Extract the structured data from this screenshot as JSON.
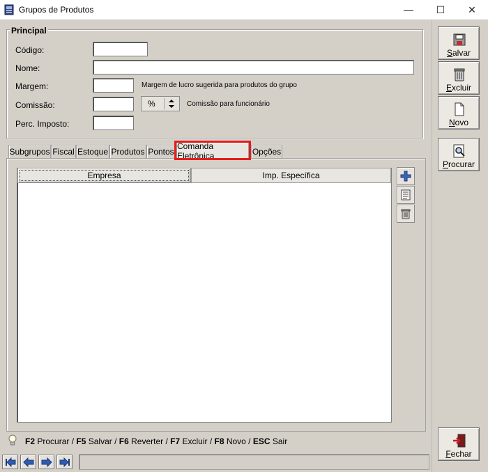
{
  "window": {
    "title": "Grupos de Produtos",
    "minimize": "—",
    "maximize": "☐",
    "close": "✕"
  },
  "principal": {
    "legend": "Principal",
    "codigo_label": "Código:",
    "codigo_value": "",
    "nome_label": "Nome:",
    "nome_value": "",
    "margem_label": "Margem:",
    "margem_value": "",
    "margem_hint": "Margem de lucro sugerida para produtos do grupo",
    "comissao_label": "Comissão:",
    "comissao_value": "",
    "comissao_unit": "%",
    "comissao_hint": "Comissão para funcionário",
    "imposto_label": "Perc. Imposto:",
    "imposto_value": ""
  },
  "tabs": {
    "subgrupos": "Subgrupos",
    "fiscal": "Fiscal",
    "estoque": "Estoque",
    "produtos": "Produtos",
    "pontos": "Pontos",
    "comanda": "Comanda Eletrônica",
    "opcoes": "Opções",
    "active": "Comanda Eletrônica"
  },
  "grid": {
    "columns": [
      "Empresa",
      "Imp. Específica"
    ],
    "rows": []
  },
  "toolbar": {
    "salvar_u": "S",
    "salvar_rest": "alvar",
    "excluir_u": "E",
    "excluir_rest": "xcluir",
    "novo_u": "N",
    "novo_rest": "ovo",
    "procurar_u": "P",
    "procurar_rest": "rocurar",
    "fechar_u": "F",
    "fechar_rest": "echar"
  },
  "shortcuts": {
    "k1": "F2",
    "t1": " Procurar / ",
    "k2": "F5",
    "t2": " Salvar / ",
    "k3": "F6",
    "t3": " Reverter / ",
    "k4": "F7",
    "t4": " Excluir / ",
    "k5": "F8",
    "t5": " Novo / ",
    "k6": "ESC",
    "t6": " Sair"
  },
  "status_text": ""
}
